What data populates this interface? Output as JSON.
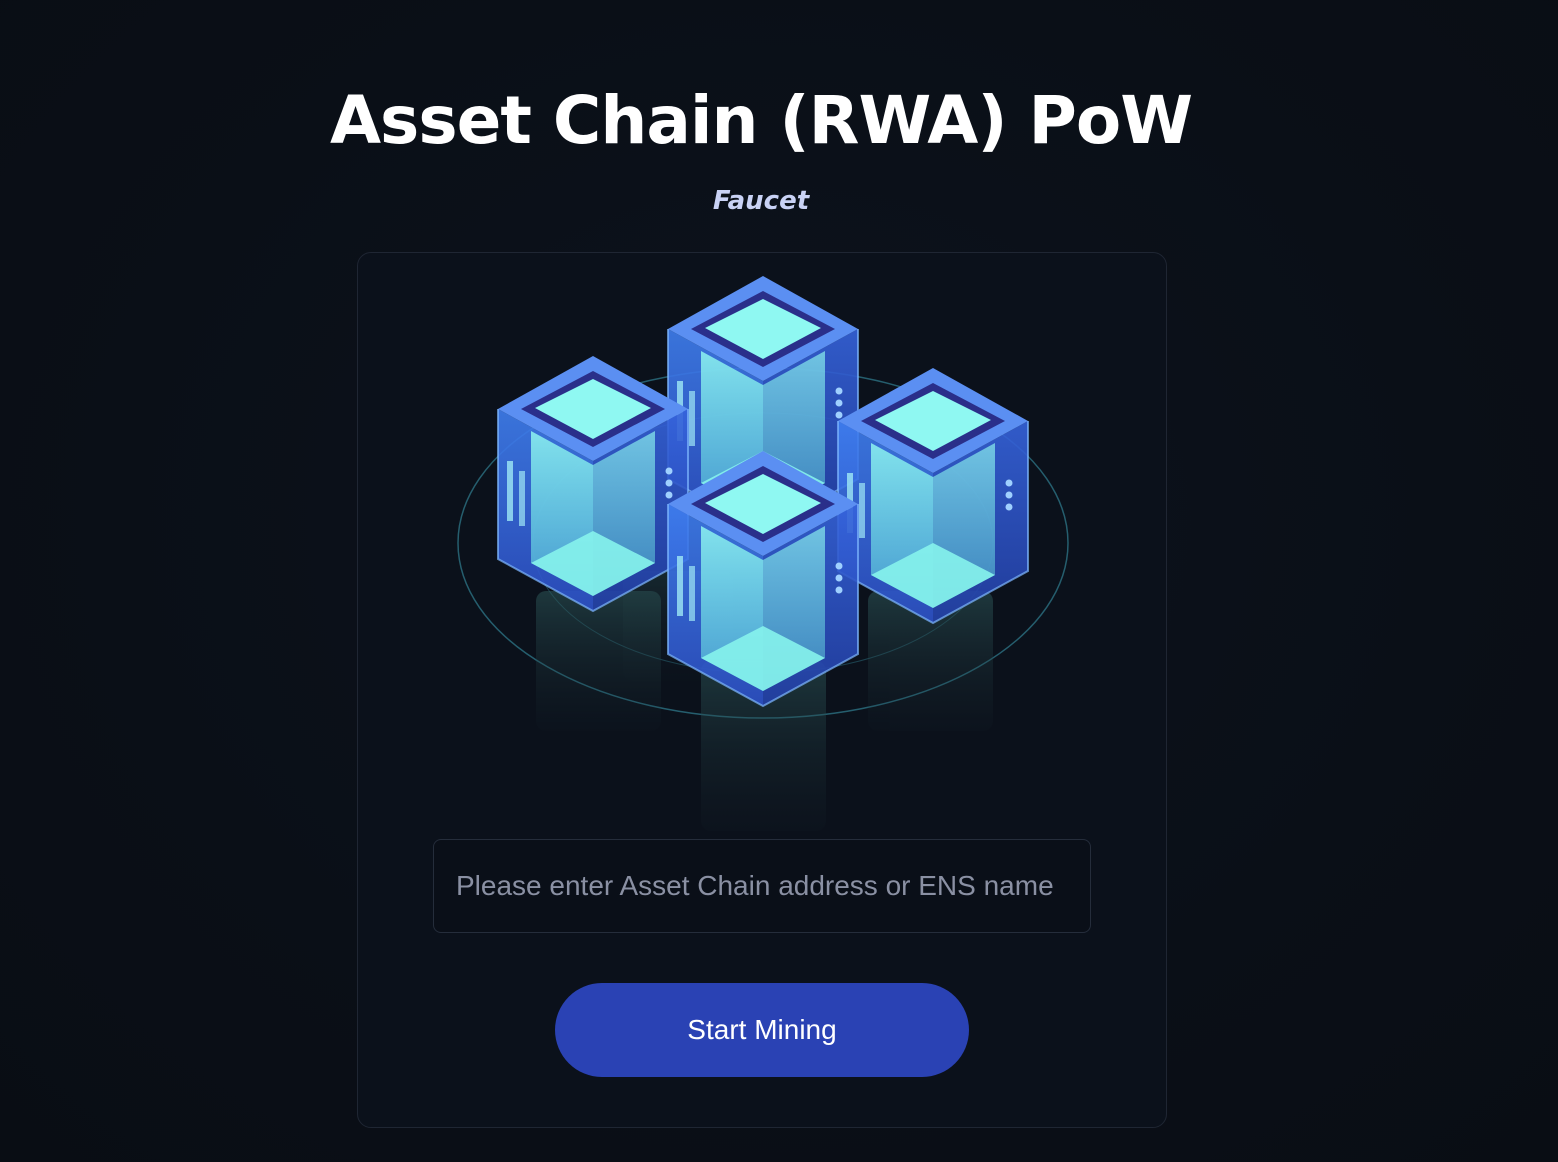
{
  "header": {
    "title": "Asset Chain (RWA) PoW",
    "subtitle": "Faucet"
  },
  "illustration": {
    "icon": "blockchain-cubes-icon"
  },
  "form": {
    "address_placeholder": "Please enter Asset Chain address or ENS name",
    "address_value": "",
    "submit_label": "Start Mining"
  },
  "colors": {
    "background": "#0a0f17",
    "card": "#0b111b",
    "accent_button": "#2a42b4",
    "cube_glow": "#7ff3ee",
    "cube_body": "#3a6fe0"
  }
}
